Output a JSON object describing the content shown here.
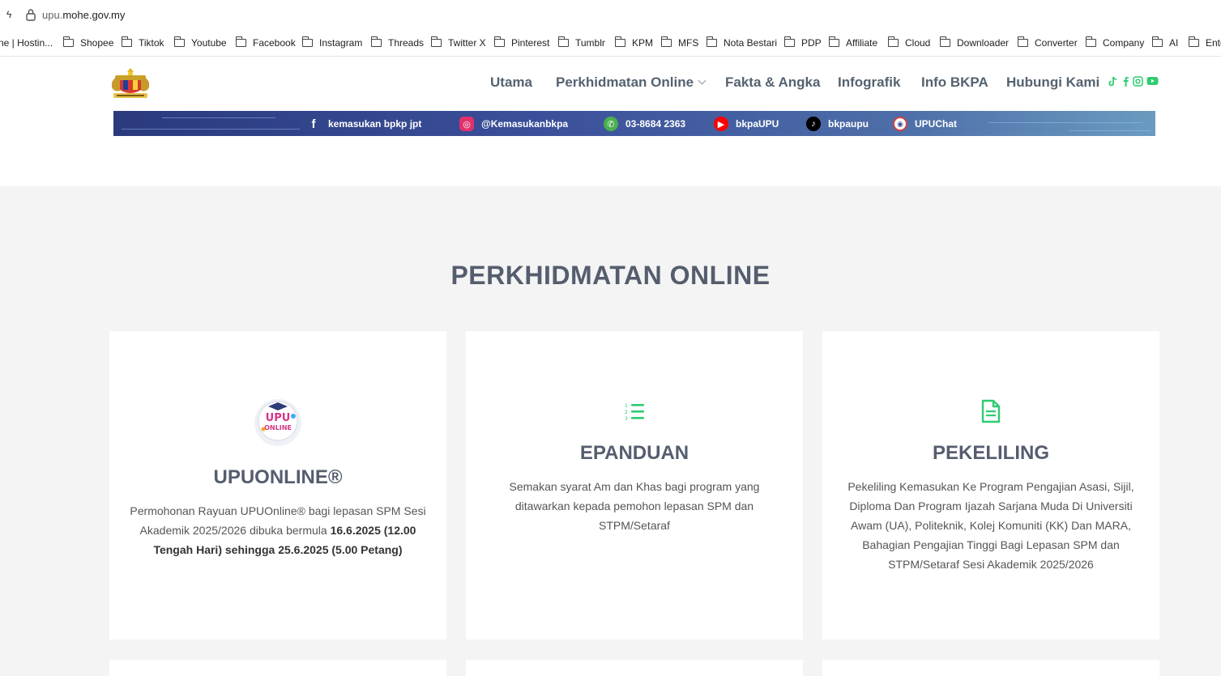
{
  "browser": {
    "url_sub": "upu.",
    "url_main": "mohe.gov.my",
    "bookmarks": [
      "ne | Hostin...",
      "Shopee",
      "Tiktok",
      "Youtube",
      "Facebook",
      "Instagram",
      "Threads",
      "Twitter X",
      "Pinterest",
      "Tumblr",
      "KPM",
      "MFS",
      "Nota Bestari",
      "PDP",
      "Affiliate",
      "Cloud",
      "Downloader",
      "Converter",
      "Company",
      "AI",
      "Ente"
    ]
  },
  "nav": {
    "items": [
      "Utama",
      "Perkhidmatan Online",
      "Fakta & Angka",
      "Infografik",
      "Info BKPA",
      "Hubungi Kami"
    ]
  },
  "banner": {
    "facebook": "kemasukan bpkp jpt",
    "instagram": "@Kemasukanbkpa",
    "phone": "03-8684 2363",
    "youtube": "bkpaUPU",
    "tiktok": "bkpaupu",
    "chat": "UPUChat"
  },
  "section": {
    "title": "PERKHIDMATAN ONLINE"
  },
  "cards": [
    {
      "title": "UPUONLINE®",
      "logo_text_1": "UPU",
      "logo_text_2": "ONLINE",
      "desc_plain": "Permohonan Rayuan UPUOnline® bagi lepasan SPM Sesi Akademik 2025/2026 dibuka bermula ",
      "desc_bold": "16.6.2025 (12.00 Tengah Hari) sehingga 25.6.2025 (5.00 Petang)"
    },
    {
      "title": "EPANDUAN",
      "desc": "Semakan syarat Am dan Khas bagi program yang ditawarkan kepada pemohon lepasan SPM dan STPM/Setaraf"
    },
    {
      "title": "PEKELILING",
      "desc": "Pekeliling Kemasukan Ke Program Pengajian Asasi, Sijil, Diploma Dan Program Ijazah Sarjana Muda Di Universiti Awam (UA), Politeknik, Kolej Komuniti (KK) Dan MARA, Bahagian Pengajian Tinggi Bagi Lepasan SPM dan STPM/Setaraf Sesi Akademik 2025/2026"
    }
  ],
  "colors": {
    "accent_green": "#2ecc71",
    "heading": "#555d6e"
  }
}
